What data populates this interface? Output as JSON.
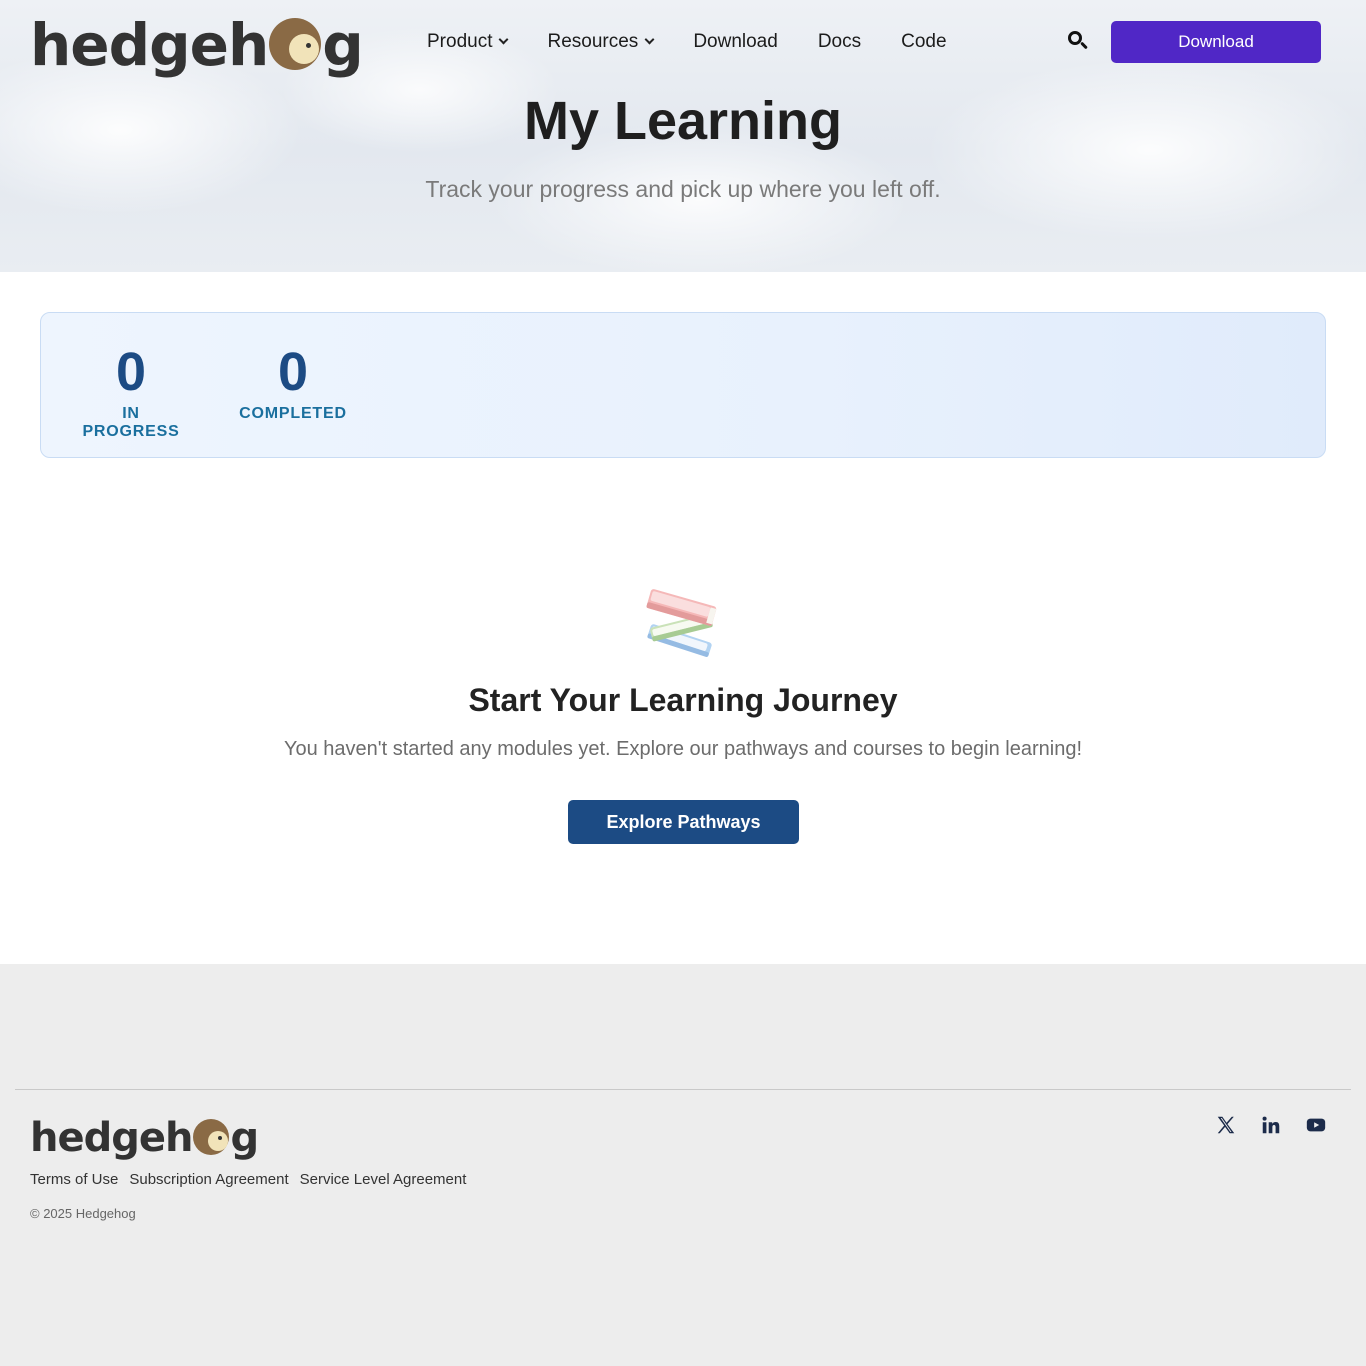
{
  "header": {
    "logo": {
      "left": "hedgeh",
      "right": "g"
    },
    "nav": [
      {
        "label": "Product",
        "has_dropdown": true
      },
      {
        "label": "Resources",
        "has_dropdown": true
      },
      {
        "label": "Download",
        "has_dropdown": false
      },
      {
        "label": "Docs",
        "has_dropdown": false
      },
      {
        "label": "Code",
        "has_dropdown": false
      }
    ],
    "search_icon": "search-icon",
    "cta_label": "Download",
    "cta_color": "#5027c6"
  },
  "hero": {
    "title": "My Learning",
    "subtitle": "Track your progress and pick up where you left off."
  },
  "stats": [
    {
      "value": "0",
      "label": "IN PROGRESS"
    },
    {
      "value": "0",
      "label": "COMPLETED"
    }
  ],
  "empty_state": {
    "icon": "books-icon",
    "title": "Start Your Learning Journey",
    "text": "You haven't started any modules yet. Explore our pathways and courses to begin learning!",
    "button_label": "Explore Pathways",
    "button_color": "#1c4b84"
  },
  "footer": {
    "logo": {
      "left": "hedgeh",
      "right": "g"
    },
    "links": [
      "Terms of Use",
      "Subscription Agreement",
      "Service Level Agreement"
    ],
    "copyright": "© 2025 Hedgehog",
    "social": [
      "x-icon",
      "linkedin-icon",
      "youtube-icon"
    ]
  }
}
